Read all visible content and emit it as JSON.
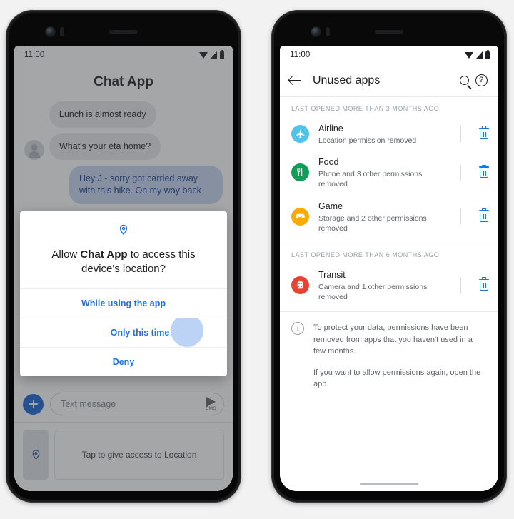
{
  "left_phone": {
    "status_bar": {
      "time": "11:00",
      "icons": [
        "wifi-icon",
        "signal-icon",
        "battery-icon"
      ]
    },
    "app_title": "Chat App",
    "messages": [
      {
        "text": "Lunch is almost ready",
        "from": "them",
        "avatar": false
      },
      {
        "text": "What's your eta home?",
        "from": "them",
        "avatar": true
      },
      {
        "text": "Hey J - sorry got carried away with this hike. On my way back",
        "from": "me",
        "avatar": false
      }
    ],
    "compose": {
      "add_button": "plus-icon",
      "placeholder": "Text message",
      "send_icon": "send-icon",
      "send_label": "SMS"
    },
    "location_strip": {
      "pin_button": "location-pin-icon",
      "card_label": "Tap to give access to Location"
    },
    "dialog": {
      "icon": "location-pin-icon",
      "title_prefix": "Allow ",
      "title_app": "Chat App",
      "title_suffix": " to access this device's location?",
      "options": [
        {
          "label": "While using the app",
          "pressed": false
        },
        {
          "label": "Only this time",
          "pressed": true
        },
        {
          "label": "Deny",
          "pressed": false
        }
      ]
    }
  },
  "right_phone": {
    "status_bar": {
      "time": "11:00",
      "icons": [
        "wifi-icon",
        "signal-icon",
        "battery-icon"
      ]
    },
    "app_bar": {
      "back": "back-arrow-icon",
      "title": "Unused apps",
      "search": "search-icon",
      "help": "help-icon",
      "help_glyph": "?"
    },
    "sections": [
      {
        "header": "LAST OPENED MORE THAN 3 MONTHS AGO",
        "apps": [
          {
            "name": "Airline",
            "subtitle": "Location permission removed",
            "icon": "airplane-icon",
            "glyph": "✈",
            "color": "#4fc3e8",
            "delete": "trash-icon"
          },
          {
            "name": "Food",
            "subtitle": "Phone and 3 other permissions removed",
            "icon": "restaurant-icon",
            "glyph": "🍴",
            "color": "#0f9d58",
            "delete": "trash-icon"
          },
          {
            "name": "Game",
            "subtitle": "Storage and 2 other permissions removed",
            "icon": "gamepad-icon",
            "glyph": "🎮",
            "color": "#f9ab00",
            "delete": "trash-icon"
          }
        ]
      },
      {
        "header": "LAST OPENED MORE THAN 6 MONTHS AGO",
        "apps": [
          {
            "name": "Transit",
            "subtitle": "Camera and 1 other permissions removed",
            "icon": "train-icon",
            "glyph": "🚆",
            "color": "#e94235",
            "delete": "trash-icon"
          }
        ]
      }
    ],
    "info": {
      "icon": "info-icon",
      "glyph": "i",
      "paragraph1": "To protect your data, permissions have been removed from  apps that you haven't used in a few months.",
      "paragraph2": "If you want to allow permissions again, open the app."
    },
    "gesture_bar": "home-gesture-bar"
  },
  "colors": {
    "accent_blue": "#1a73e8",
    "bubble_them": "#e8eaed",
    "bubble_me": "#c9d7f2",
    "text_primary": "#202124",
    "text_secondary": "#5f6368"
  }
}
